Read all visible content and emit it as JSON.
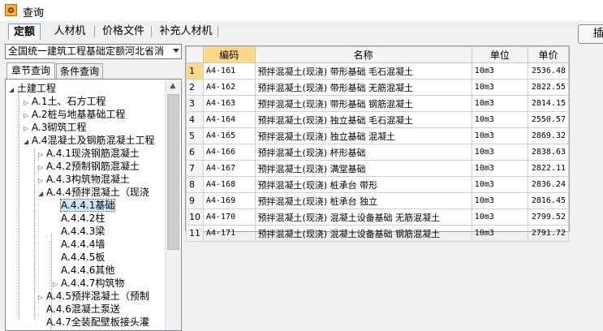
{
  "window": {
    "title": "查询"
  },
  "tabs": [
    {
      "label": "定额",
      "active": true
    },
    {
      "label": "人材机",
      "active": false
    },
    {
      "label": "价格文件",
      "active": false
    },
    {
      "label": "补充人材机",
      "active": false
    }
  ],
  "insert_button": {
    "label": "插"
  },
  "library_select": {
    "value": "全国统一建筑工程基础定额河北省消"
  },
  "subtabs": [
    {
      "label": "章节查询",
      "active": true
    },
    {
      "label": "条件查询",
      "active": false
    }
  ],
  "tree": [
    {
      "label": "土建工程",
      "level": 0,
      "toggle": "expanded"
    },
    {
      "label": "A.1土、石方工程",
      "level": 1,
      "toggle": "collapsed"
    },
    {
      "label": "A.2桩与地基基础工程",
      "level": 1,
      "toggle": "collapsed"
    },
    {
      "label": "A.3砌筑工程",
      "level": 1,
      "toggle": "collapsed"
    },
    {
      "label": "A.4混凝土及钢筋混凝土工程",
      "level": 1,
      "toggle": "expanded"
    },
    {
      "label": "A.4.1现浇钢筋混凝土",
      "level": 2,
      "toggle": "collapsed"
    },
    {
      "label": "A.4.2预制钢筋混凝土",
      "level": 2,
      "toggle": "collapsed"
    },
    {
      "label": "A.4.3构筑物混凝土",
      "level": 2,
      "toggle": "collapsed"
    },
    {
      "label": "A.4.4预拌混凝土（现浇",
      "level": 2,
      "toggle": "expanded"
    },
    {
      "label": "A.4.4.1基础",
      "level": 3,
      "toggle": "none",
      "selected": true
    },
    {
      "label": "A.4.4.2柱",
      "level": 3,
      "toggle": "none"
    },
    {
      "label": "A.4.4.3梁",
      "level": 3,
      "toggle": "none"
    },
    {
      "label": "A.4.4.4墙",
      "level": 3,
      "toggle": "none"
    },
    {
      "label": "A.4.4.5板",
      "level": 3,
      "toggle": "none"
    },
    {
      "label": "A.4.4.6其他",
      "level": 3,
      "toggle": "none"
    },
    {
      "label": "A.4.4.7构筑物",
      "level": 3,
      "toggle": "collapsed"
    },
    {
      "label": "A.4.5预拌混凝土（预制",
      "level": 2,
      "toggle": "collapsed"
    },
    {
      "label": "A.4.6混凝土泵送",
      "level": 2,
      "toggle": "none"
    },
    {
      "label": "A.4.7全装配壁板接头灌",
      "level": 2,
      "toggle": "none"
    }
  ],
  "table": {
    "columns": [
      "编码",
      "名称",
      "单位",
      "单价"
    ],
    "rows": [
      {
        "n": "1",
        "code": "A4-161",
        "name": "预拌混凝土(现浇) 带形基础 毛石混凝土",
        "unit": "10m3",
        "price": "2536.48"
      },
      {
        "n": "2",
        "code": "A4-162",
        "name": "预拌混凝土(现浇) 带形基础 无筋混凝土",
        "unit": "10m3",
        "price": "2822.55"
      },
      {
        "n": "3",
        "code": "A4-163",
        "name": "预拌混凝土(现浇) 带形基础 钢筋混凝土",
        "unit": "10m3",
        "price": "2814.15"
      },
      {
        "n": "4",
        "code": "A4-164",
        "name": "预拌混凝土(现浇) 独立基础 毛石混凝土",
        "unit": "10m3",
        "price": "2550.57"
      },
      {
        "n": "5",
        "code": "A4-165",
        "name": "预拌混凝土(现浇) 独立基础 混凝土",
        "unit": "10m3",
        "price": "2869.32"
      },
      {
        "n": "6",
        "code": "A4-166",
        "name": "预拌混凝土(现浇) 杯形基础",
        "unit": "10m3",
        "price": "2838.63"
      },
      {
        "n": "7",
        "code": "A4-167",
        "name": "预拌混凝土(现浇) 满堂基础",
        "unit": "10m3",
        "price": "2822.11"
      },
      {
        "n": "8",
        "code": "A4-168",
        "name": "预拌混凝土(现浇) 桩承台 带形",
        "unit": "10m3",
        "price": "2836.24"
      },
      {
        "n": "9",
        "code": "A4-169",
        "name": "预拌混凝土(现浇) 桩承台 独立",
        "unit": "10m3",
        "price": "2816.45"
      },
      {
        "n": "10",
        "code": "A4-170",
        "name": "预拌混凝土(现浇) 混凝土设备基础 无筋混凝土",
        "unit": "10m3",
        "price": "2799.52"
      },
      {
        "n": "11",
        "code": "A4-171",
        "name": "预拌混凝土(现浇) 混凝土设备基础 钢筋混凝土",
        "unit": "10m3",
        "price": "2791.72"
      }
    ]
  }
}
